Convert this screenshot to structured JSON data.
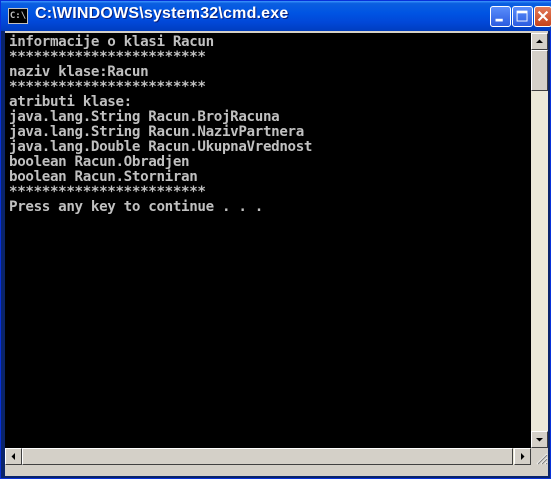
{
  "window": {
    "icon_text": "C:\\",
    "title": "C:\\WINDOWS\\system32\\cmd.exe"
  },
  "console": {
    "lines": [
      "informacije o klasi Racun",
      "************************",
      "naziv klase:Racun",
      "************************",
      "atributi klase:",
      "java.lang.String Racun.BrojRacuna",
      "java.lang.String Racun.NazivPartnera",
      "java.lang.Double Racun.UkupnaVrednost",
      "boolean Racun.Obradjen",
      "boolean Racun.Storniran",
      "************************",
      "Press any key to continue . . ."
    ]
  },
  "colors": {
    "console_bg": "#000000",
    "console_text": "#c0c0c0",
    "titlebar": "#0054e3"
  },
  "icons": {
    "title": "cmd-icon",
    "minimize": "minimize-icon",
    "maximize": "maximize-icon",
    "close": "close-icon",
    "scroll_up": "arrow-up-icon",
    "scroll_down": "arrow-down-icon",
    "scroll_left": "arrow-left-icon",
    "scroll_right": "arrow-right-icon",
    "grip": "resize-grip-icon"
  }
}
